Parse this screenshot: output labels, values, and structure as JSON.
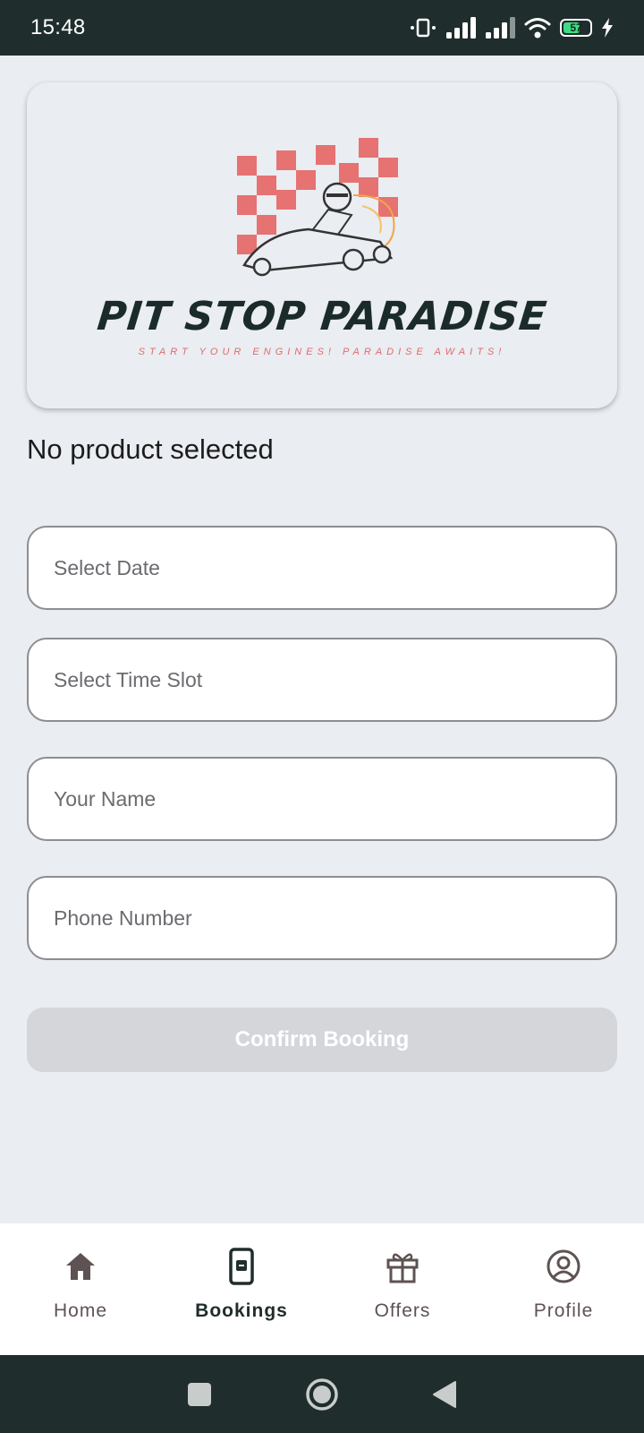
{
  "status_bar": {
    "time": "15:48",
    "battery_level": "57",
    "icons": [
      "vibrate-icon",
      "signal-icon",
      "signal-icon",
      "wifi-icon",
      "battery-icon",
      "charging-icon"
    ]
  },
  "logo": {
    "title": "PIT STOP PARADISE",
    "tagline": "START YOUR ENGINES! PARADISE AWAITS!"
  },
  "booking": {
    "product_status": "No product selected",
    "date_placeholder": "Select Date",
    "time_placeholder": "Select Time Slot",
    "name_placeholder": "Your Name",
    "phone_placeholder": "Phone Number",
    "confirm_label": "Confirm Booking",
    "confirm_enabled": false
  },
  "bottom_nav": {
    "items": [
      {
        "label": "Home",
        "icon": "home-icon",
        "active": false
      },
      {
        "label": "Bookings",
        "icon": "bookings-icon",
        "active": true
      },
      {
        "label": "Offers",
        "icon": "gift-icon",
        "active": false
      },
      {
        "label": "Profile",
        "icon": "profile-icon",
        "active": false
      }
    ]
  },
  "system_nav": {
    "icons": [
      "recents-icon",
      "home-circle-icon",
      "back-icon"
    ]
  },
  "colors": {
    "status_bar_bg": "#1f2d2c",
    "page_bg": "#eaedf1",
    "brand_red": "#e06b6b",
    "brand_dark": "#1b2b2a",
    "disabled_button": "#d4d6da"
  }
}
